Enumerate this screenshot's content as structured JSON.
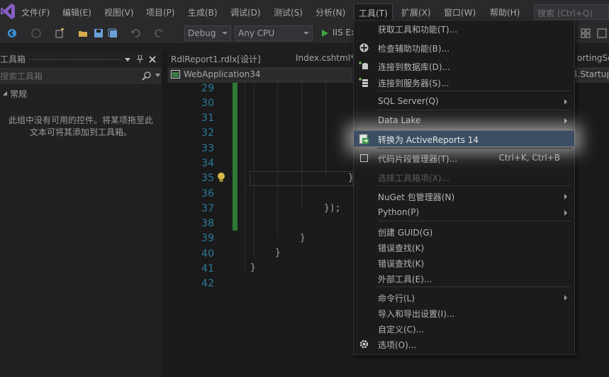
{
  "menubar": {
    "items": [
      {
        "label": "文件(F)"
      },
      {
        "label": "编辑(E)"
      },
      {
        "label": "视图(V)"
      },
      {
        "label": "项目(P)"
      },
      {
        "label": "生成(B)"
      },
      {
        "label": "调试(D)"
      },
      {
        "label": "测试(S)"
      },
      {
        "label": "分析(N)"
      },
      {
        "label": "工具(T)"
      },
      {
        "label": "扩展(X)"
      },
      {
        "label": "窗口(W)"
      },
      {
        "label": "帮助(H)"
      }
    ],
    "search_placeholder": "搜索 (Ctrl+Q)"
  },
  "toolbar": {
    "config": "Debug",
    "platform": "Any CPU",
    "run_label": "IIS Ex"
  },
  "toolbox": {
    "title": "工具箱",
    "search_placeholder": "搜索工具箱",
    "group": "常规",
    "empty_message_line1": "此组中没有可用的控件。将某项拖至此",
    "empty_message_line2": "文本可将其添加到工具箱。"
  },
  "tabs": [
    {
      "label": "RdlReport1.rdlx[设计]"
    },
    {
      "label": "Index.cshtml*"
    },
    {
      "label": "ortingSet"
    }
  ],
  "navbar": {
    "project": "WebApplication34",
    "right": "4.Startup"
  },
  "editor": {
    "line_numbers": [
      "29",
      "30",
      "31",
      "32",
      "33",
      "34",
      "35",
      "36",
      "37",
      "38",
      "39",
      "40",
      "41",
      "42"
    ],
    "code": {
      "brace_35": "}",
      "close_37": "});",
      "brace_39": "}",
      "brace_40": "}",
      "brace_41": "}"
    }
  },
  "tools_menu": {
    "items": [
      {
        "label": "获取工具和功能(T)..."
      },
      {
        "label": "检查辅助功能(B)..."
      },
      {
        "label": "连接到数据库(D)..."
      },
      {
        "label": "连接到服务器(S)..."
      },
      {
        "label": "SQL Server(Q)"
      },
      {
        "label": "Data Lake"
      },
      {
        "label": "转换为 ActiveReports 14"
      },
      {
        "label": "代码片段管理器(T)...",
        "shortcut": "Ctrl+K, Ctrl+B"
      },
      {
        "label": "选择工具箱项(X)..."
      },
      {
        "label": "NuGet 包管理器(N)"
      },
      {
        "label": "Python(P)"
      },
      {
        "label": "创建 GUID(G)"
      },
      {
        "label": "错误查找(K)"
      },
      {
        "label": "错误查找(K)"
      },
      {
        "label": "外部工具(E)..."
      },
      {
        "label": "命令行(L)"
      },
      {
        "label": "导入和导出设置(I)..."
      },
      {
        "label": "自定义(C)..."
      },
      {
        "label": "选项(O)..."
      }
    ]
  }
}
